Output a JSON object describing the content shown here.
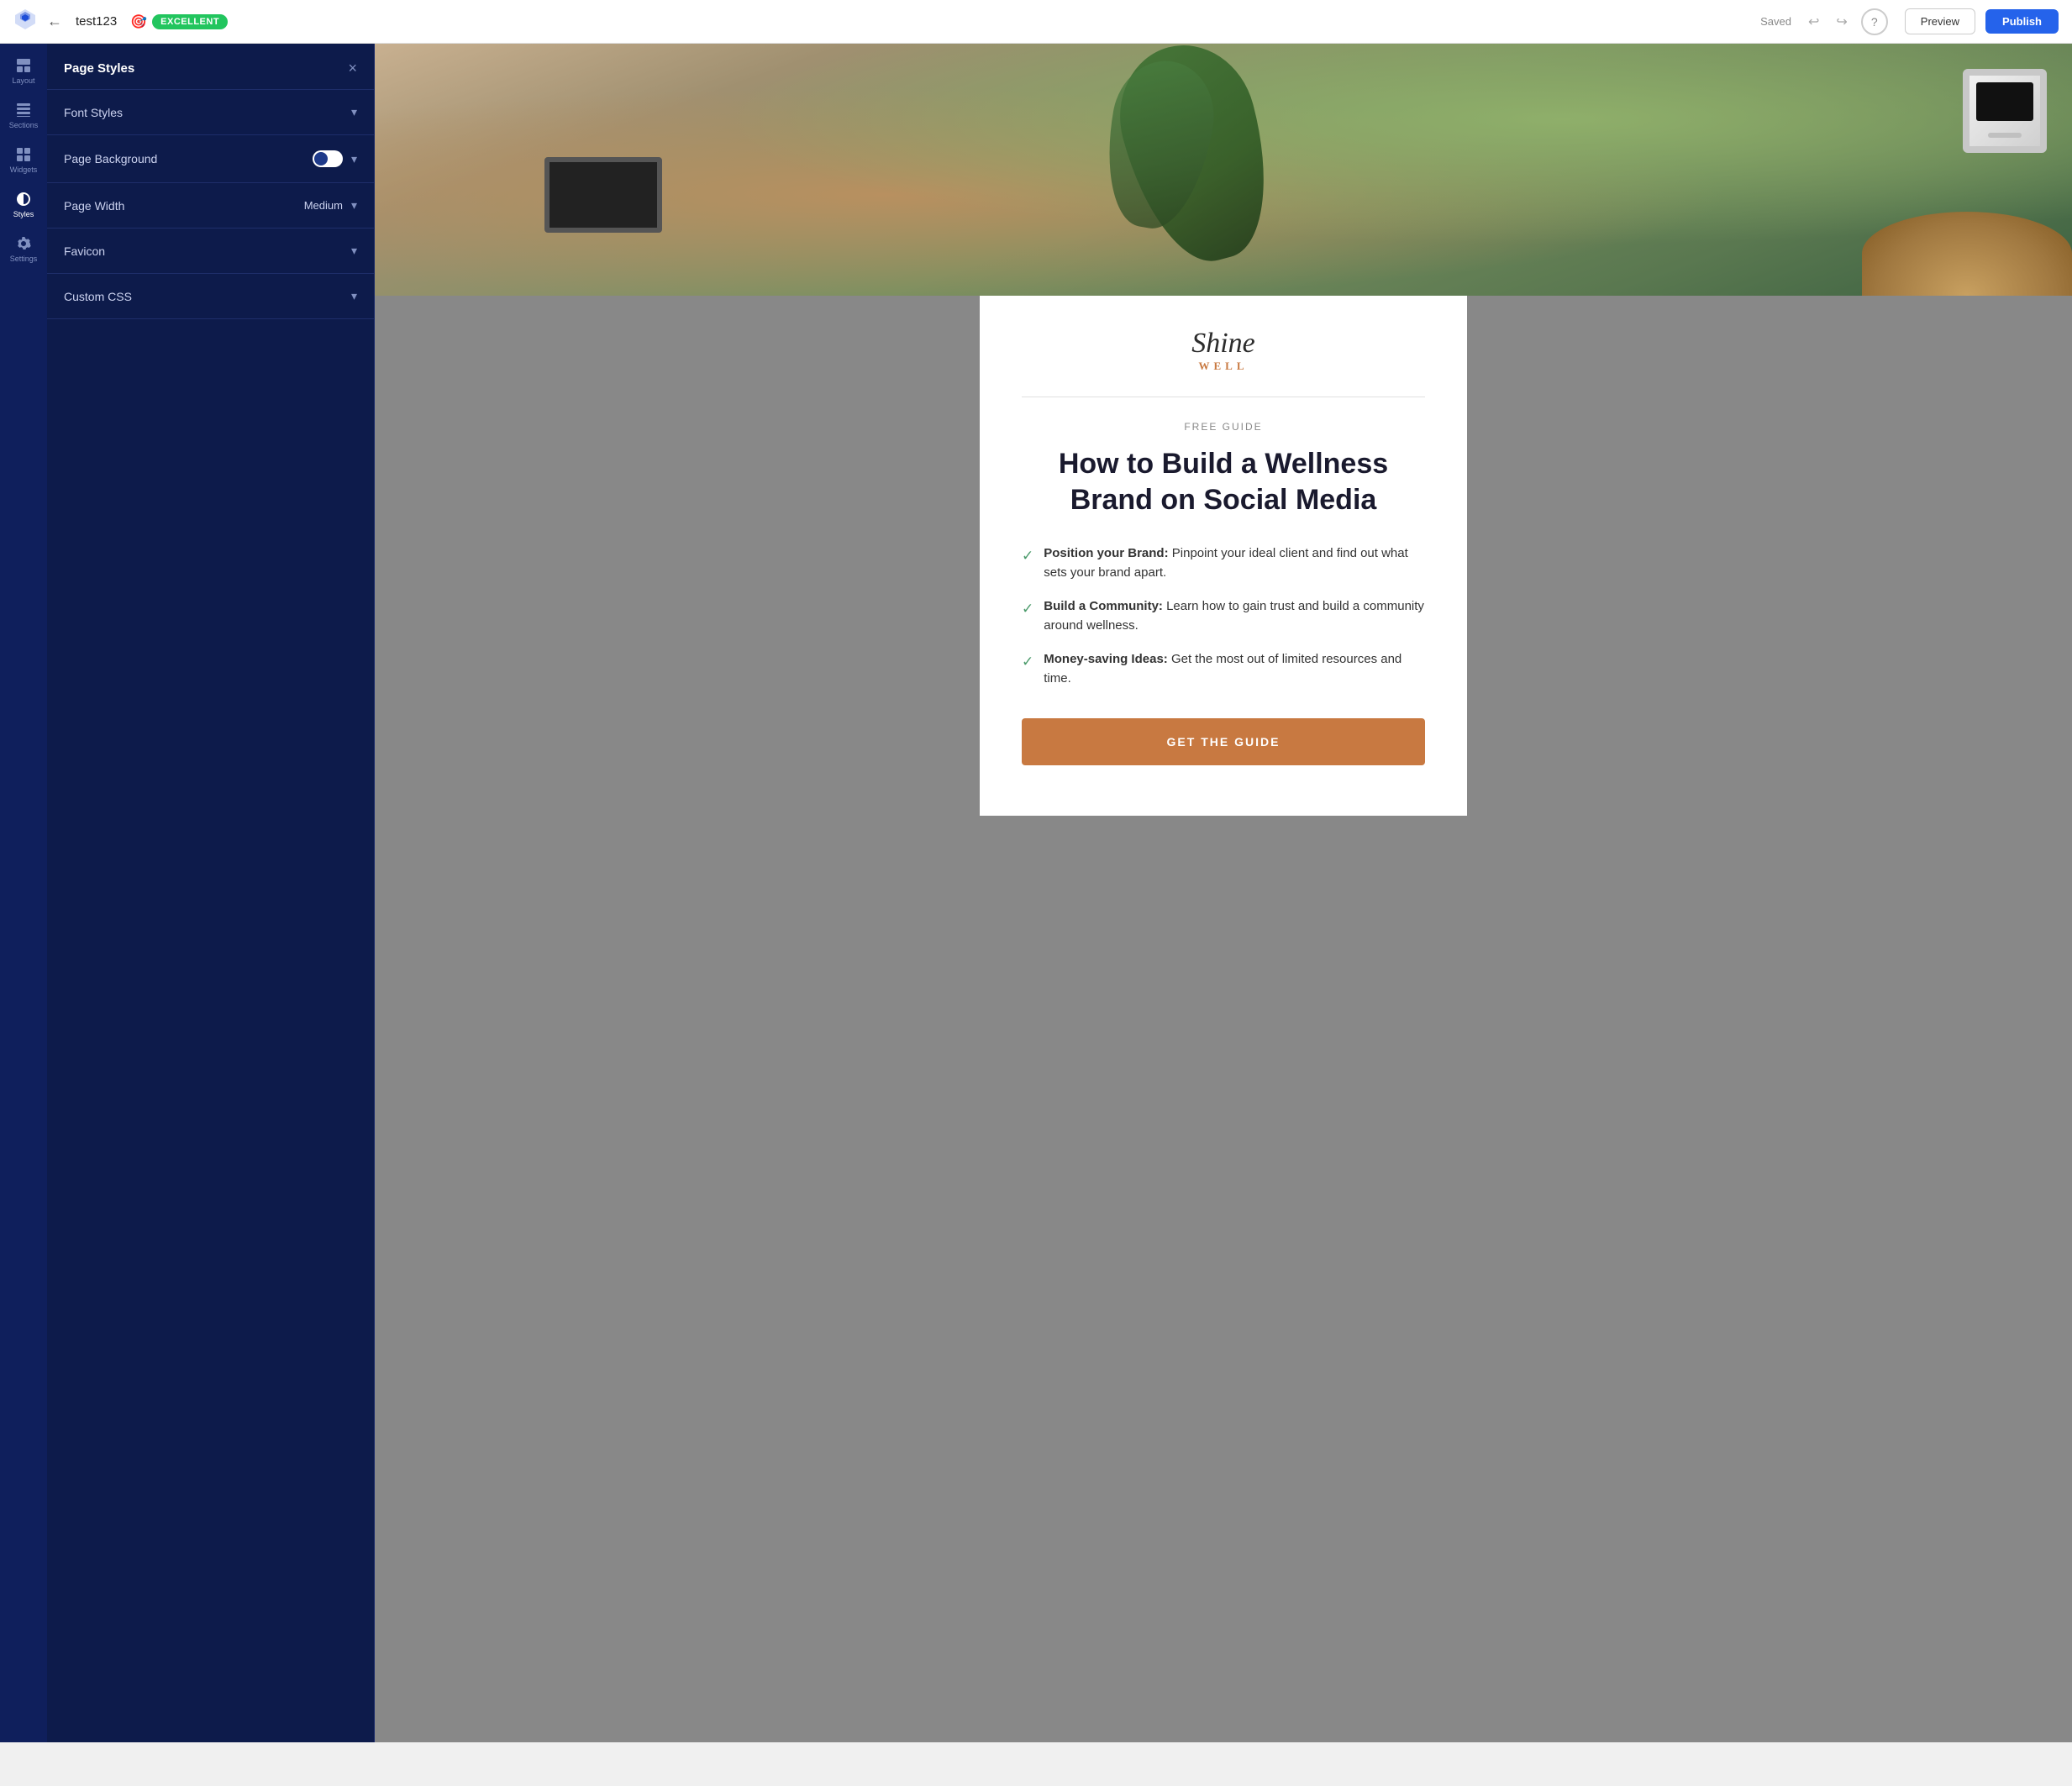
{
  "topbar": {
    "logo_alt": "Logo",
    "back_label": "←",
    "title": "test123",
    "badge_text": "EXCELLENT",
    "saved_text": "Saved",
    "undo_label": "↩",
    "redo_label": "↪",
    "help_label": "?",
    "preview_label": "Preview",
    "publish_label": "Publish"
  },
  "icon_nav": {
    "items": [
      {
        "id": "layout",
        "label": "Layout",
        "active": false
      },
      {
        "id": "sections",
        "label": "Sections",
        "active": false
      },
      {
        "id": "widgets",
        "label": "Widgets",
        "active": false
      },
      {
        "id": "styles",
        "label": "Styles",
        "active": true
      },
      {
        "id": "settings",
        "label": "Settings",
        "active": false
      }
    ]
  },
  "panel": {
    "title": "Page Styles",
    "close_label": "×",
    "sections": [
      {
        "id": "font-styles",
        "label": "Font Styles",
        "value": "",
        "has_toggle": false
      },
      {
        "id": "page-background",
        "label": "Page Background",
        "value": "",
        "has_toggle": true
      },
      {
        "id": "page-width",
        "label": "Page Width",
        "value": "Medium",
        "has_toggle": false
      },
      {
        "id": "favicon",
        "label": "Favicon",
        "value": "",
        "has_toggle": false
      },
      {
        "id": "custom-css",
        "label": "Custom CSS",
        "value": "",
        "has_toggle": false
      }
    ]
  },
  "preview": {
    "free_guide_tag": "FREE GUIDE",
    "headline": "How to Build a Wellness Brand on Social Media",
    "logo_main": "Shine",
    "logo_sub": "WELL",
    "bullet_items": [
      {
        "label": "Position your Brand:",
        "text": " Pinpoint your ideal client and find out what sets your brand apart."
      },
      {
        "label": "Build a Community:",
        "text": " Learn how to gain trust and build a community around wellness."
      },
      {
        "label": "Money-saving Ideas:",
        "text": " Get the most out of limited resources and time."
      }
    ],
    "cta_button": "GET THE GUIDE"
  },
  "colors": {
    "topbar_bg": "#ffffff",
    "nav_bg": "#0f1f5c",
    "panel_bg": "#0d1b4b",
    "badge_green": "#22c55e",
    "publish_blue": "#2563eb",
    "accent_orange": "#c87941",
    "check_green": "#4a9a6a"
  }
}
